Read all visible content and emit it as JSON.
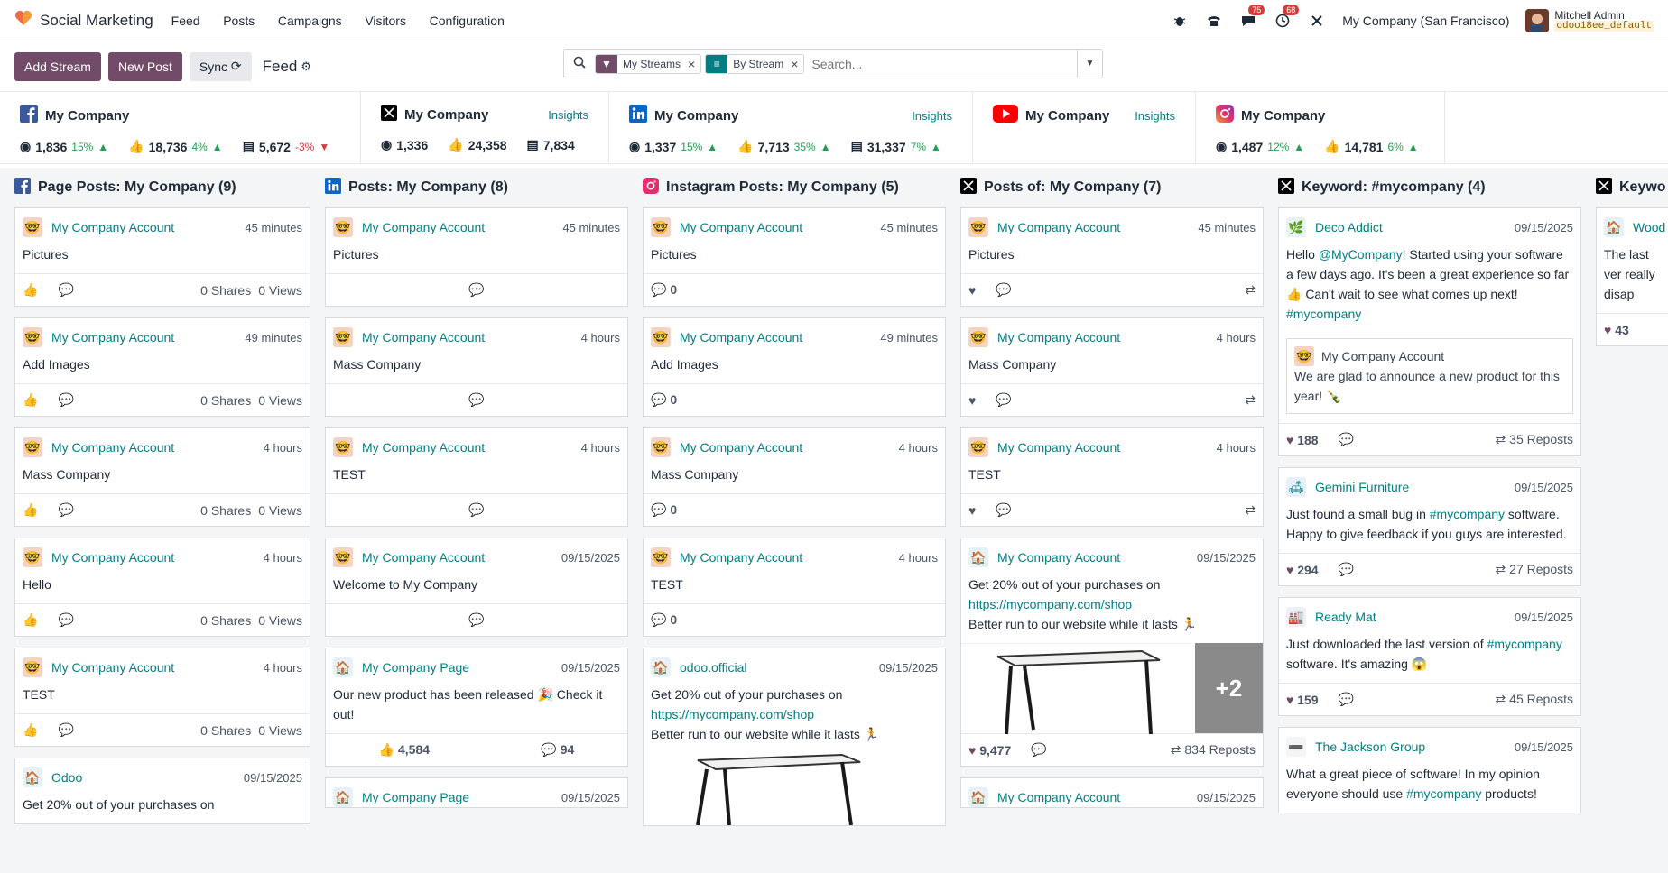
{
  "app": {
    "name": "Social Marketing"
  },
  "menu": [
    "Feed",
    "Posts",
    "Campaigns",
    "Visitors",
    "Configuration"
  ],
  "nav": {
    "chat_count": "75",
    "activity_count": "68",
    "company": "My Company (San Francisco)",
    "user_name": "Mitchell Admin",
    "db_name": "odoo18ee_default"
  },
  "toolbar": {
    "add_stream": "Add Stream",
    "new_post": "New Post",
    "sync": "Sync",
    "title": "Feed"
  },
  "search": {
    "facet1": "My Streams",
    "facet2": "By Stream",
    "placeholder": "Search..."
  },
  "accounts": [
    {
      "network": "facebook",
      "name": "My Company",
      "insights": "",
      "stats": [
        {
          "value": "1,836",
          "trend": "15%",
          "dir": "up"
        },
        {
          "value": "18,736",
          "trend": "4%",
          "dir": "up"
        },
        {
          "value": "5,672",
          "trend": "-3%",
          "dir": "down"
        }
      ]
    },
    {
      "network": "x",
      "name": "My Company",
      "insights": "Insights",
      "stats": [
        {
          "value": "1,336",
          "trend": "",
          "dir": ""
        },
        {
          "value": "24,358",
          "trend": "",
          "dir": ""
        },
        {
          "value": "7,834",
          "trend": "",
          "dir": ""
        }
      ]
    },
    {
      "network": "linkedin",
      "name": "My Company",
      "insights": "Insights",
      "stats": [
        {
          "value": "1,337",
          "trend": "15%",
          "dir": "up"
        },
        {
          "value": "7,713",
          "trend": "35%",
          "dir": "up"
        },
        {
          "value": "31,337",
          "trend": "7%",
          "dir": "up"
        }
      ]
    },
    {
      "network": "youtube",
      "name": "My Company",
      "insights": "Insights",
      "stats": []
    },
    {
      "network": "instagram",
      "name": "My Company",
      "insights": "",
      "stats": [
        {
          "value": "1,487",
          "trend": "12%",
          "dir": "up"
        },
        {
          "value": "14,781",
          "trend": "6%",
          "dir": "up"
        }
      ]
    }
  ],
  "streams": {
    "fb": {
      "title": "Page Posts: My Company (9)",
      "posts": [
        {
          "author": "My Company Account",
          "time": "45 minutes",
          "msg": "Pictures",
          "shares": "0 Shares",
          "views": "0 Views"
        },
        {
          "author": "My Company Account",
          "time": "49 minutes",
          "msg": "Add Images",
          "shares": "0 Shares",
          "views": "0 Views"
        },
        {
          "author": "My Company Account",
          "time": "4 hours",
          "msg": "Mass Company",
          "shares": "0 Shares",
          "views": "0 Views"
        },
        {
          "author": "My Company Account",
          "time": "4 hours",
          "msg": "Hello",
          "shares": "0 Shares",
          "views": "0 Views"
        },
        {
          "author": "My Company Account",
          "time": "4 hours",
          "msg": "TEST",
          "shares": "0 Shares",
          "views": "0 Views"
        },
        {
          "author": "Odoo",
          "time": "09/15/2025",
          "msg": "Get 20% out of your purchases on"
        }
      ]
    },
    "li": {
      "title": "Posts: My Company (8)",
      "posts": [
        {
          "author": "My Company Account",
          "time": "45 minutes",
          "msg": "Pictures"
        },
        {
          "author": "My Company Account",
          "time": "4 hours",
          "msg": "Mass Company"
        },
        {
          "author": "My Company Account",
          "time": "4 hours",
          "msg": "TEST"
        },
        {
          "author": "My Company Account",
          "time": "09/15/2025",
          "msg": "Welcome to My Company"
        },
        {
          "author": "My Company Page",
          "time": "09/15/2025",
          "msg": "Our new product has been released 🎉 Check it out!",
          "likes": "4,584",
          "comments": "94"
        },
        {
          "author": "My Company Page",
          "time": "09/15/2025",
          "msg": ""
        }
      ]
    },
    "ig": {
      "title": "Instagram Posts: My Company (5)",
      "posts": [
        {
          "author": "My Company Account",
          "time": "45 minutes",
          "msg": "Pictures",
          "comments": "0"
        },
        {
          "author": "My Company Account",
          "time": "49 minutes",
          "msg": "Add Images",
          "comments": "0"
        },
        {
          "author": "My Company Account",
          "time": "4 hours",
          "msg": "Mass Company",
          "comments": "0"
        },
        {
          "author": "My Company Account",
          "time": "4 hours",
          "msg": "TEST",
          "comments": "0"
        },
        {
          "author": "odoo.official",
          "time": "09/15/2025",
          "msg1": "Get 20% out of your purchases on",
          "link": "https://mycompany.com/shop",
          "msg2": "Better run to our website while it lasts 🏃"
        }
      ]
    },
    "x": {
      "title": "Posts of: My Company (7)",
      "posts": [
        {
          "author": "My Company Account",
          "time": "45 minutes",
          "msg": "Pictures"
        },
        {
          "author": "My Company Account",
          "time": "4 hours",
          "msg": "Mass Company"
        },
        {
          "author": "My Company Account",
          "time": "4 hours",
          "msg": "TEST"
        },
        {
          "author": "My Company Account",
          "time": "09/15/2025",
          "msg1": "Get 20% out of your purchases on",
          "link": "https://mycompany.com/shop",
          "msg2": "Better run to our website while it lasts 🏃",
          "more": "+2",
          "likes": "9,477",
          "reposts": "834 Reposts"
        },
        {
          "author": "My Company Account",
          "time": "09/15/2025",
          "msg": ""
        }
      ]
    },
    "kw": {
      "title": "Keyword: #mycompany (4)",
      "posts": [
        {
          "author": "Deco Addict",
          "time": "09/15/2025",
          "msg_a": "Hello ",
          "mention": "@MyCompany",
          "msg_b": "! Started using your software a few days ago. It's been a great experience so far 👍 Can't wait to see what comes up next!",
          "tag": "#mycompany",
          "quote_author": "My Company Account",
          "quote_msg": "We are glad to announce a new product for this year! 🍾",
          "likes": "188",
          "reposts": "35 Reposts"
        },
        {
          "author": "Gemini Furniture",
          "time": "09/15/2025",
          "msg_a": "Just found a small bug in ",
          "tag": "#mycompany",
          "msg_b": " software. Happy to give feedback if you guys are interested.",
          "likes": "294",
          "reposts": "27 Reposts"
        },
        {
          "author": "Ready Mat",
          "time": "09/15/2025",
          "msg_a": "Just downloaded the last version of ",
          "tag": "#mycompany",
          "msg_b": " software. It's amazing 😱",
          "likes": "159",
          "reposts": "45 Reposts"
        },
        {
          "author": "The Jackson Group",
          "time": "09/15/2025",
          "msg_a": "What a great piece of software! In my opinion everyone should use ",
          "tag": "#mycompany",
          "msg_b": " products!"
        }
      ]
    },
    "kw2": {
      "title": "Keywo",
      "posts": [
        {
          "author": "Wood",
          "msg": "The last ver really disap",
          "likes": "43"
        }
      ]
    }
  }
}
